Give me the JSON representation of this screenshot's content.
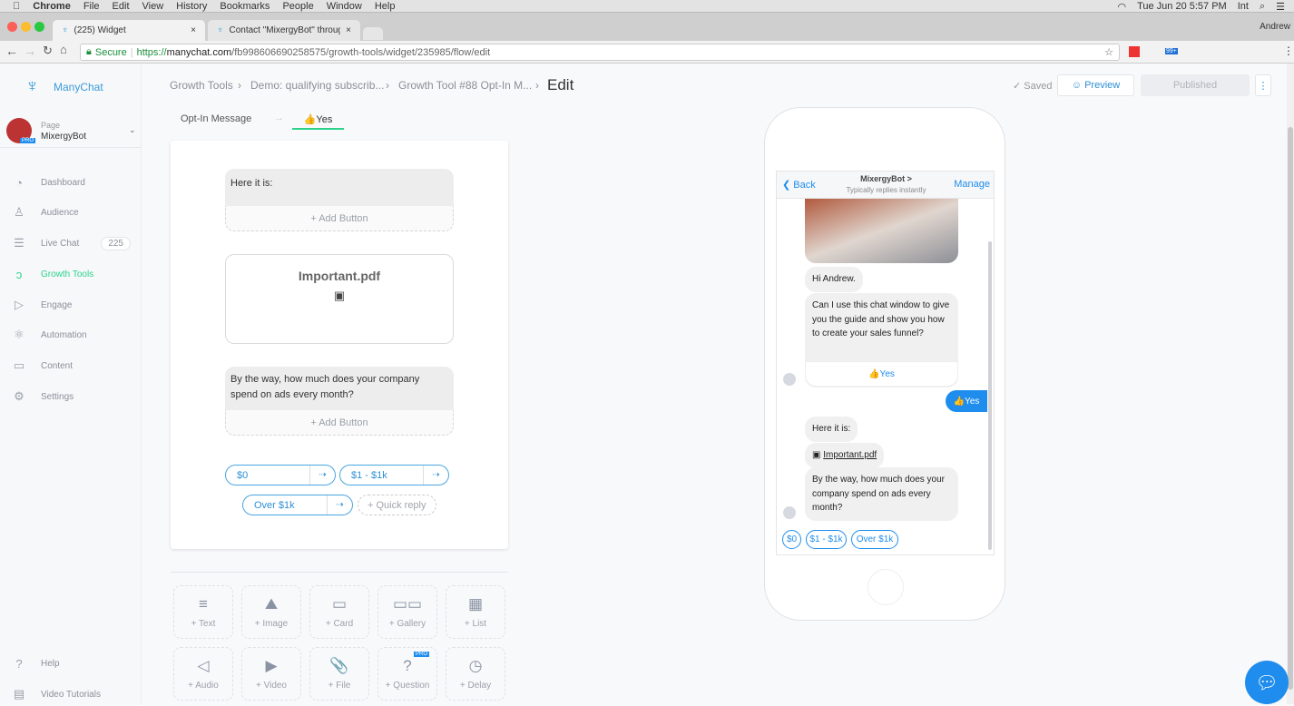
{
  "os_menu": {
    "apple": "",
    "app": "Chrome",
    "items": [
      "File",
      "Edit",
      "View",
      "History",
      "Bookmarks",
      "People",
      "Window",
      "Help"
    ],
    "clock": "Tue Jun 20  5:57 PM",
    "input": "Int"
  },
  "browser": {
    "tabs": [
      {
        "label": "(225) Widget"
      },
      {
        "label": "Contact \"MixergyBot\" through"
      }
    ],
    "profile": "Andrew",
    "secure": "Secure",
    "url_scheme": "https://",
    "url_host": "manychat.com",
    "url_path": "/fb998606690258575/growth-tools/widget/235985/flow/edit",
    "ext_badge": "99+"
  },
  "sidebar": {
    "logo": "ManyChat",
    "page_label": "Page",
    "page_name": "MixergyBot",
    "pro": "PRO",
    "items": [
      {
        "label": "Dashboard",
        "icon": "◔"
      },
      {
        "label": "Audience",
        "icon": "♙"
      },
      {
        "label": "Live Chat",
        "icon": "☰",
        "badge": "225"
      },
      {
        "label": "Growth Tools",
        "icon": "ↄ"
      },
      {
        "label": "Engage",
        "icon": "▷"
      },
      {
        "label": "Automation",
        "icon": "⚛"
      },
      {
        "label": "Content",
        "icon": "▭"
      },
      {
        "label": "Settings",
        "icon": "⚙"
      }
    ],
    "help": "Help",
    "video": "Video Tutorials"
  },
  "header": {
    "breadcrumb": [
      "Growth Tools",
      "Demo: qualifying subscrib...",
      "Growth Tool #88 Opt-In M..."
    ],
    "title": "Edit",
    "saved": "Saved",
    "preview": "Preview",
    "published": "Published"
  },
  "flow_tabs": {
    "first": "Opt-In Message",
    "arrow": "→",
    "second": "👍Yes"
  },
  "editor": {
    "msg1": "Here it is:",
    "add_button": "+ Add Button",
    "file": "Important.pdf",
    "msg2": "By the way, how much does your company spend on ads every month?",
    "quick_replies": [
      "$0",
      "$1 - $1k",
      "Over $1k"
    ],
    "add_quick_reply": "+ Quick reply"
  },
  "tiles": [
    "+ Text",
    "+ Image",
    "+ Card",
    "+ Gallery",
    "+ List",
    "+ Audio",
    "+ Video",
    "+ File",
    "+ Question",
    "+ Delay"
  ],
  "tile_icons": [
    "≡",
    "⛰",
    "▭",
    "▭▭",
    "▦",
    "◁",
    "▶",
    "📎",
    "?",
    "◷"
  ],
  "preview": {
    "back": "Back",
    "bot": "MixergyBot >",
    "sub": "Typically replies instantly",
    "manage": "Manage",
    "m1": "Hi Andrew.",
    "m2": "Can I use this chat window to give you the guide and show you how to create your sales funnel?",
    "yes_btn": "👍Yes",
    "user_reply": "👍Yes",
    "m3": "Here it is:",
    "file": "Important.pdf",
    "m4": "By the way, how much does your company spend on ads every month?",
    "qrs": [
      "$0",
      "$1 - $1k",
      "Over $1k"
    ]
  },
  "colors": {
    "accent": "#2bd38a",
    "blue": "#1f8ded"
  }
}
